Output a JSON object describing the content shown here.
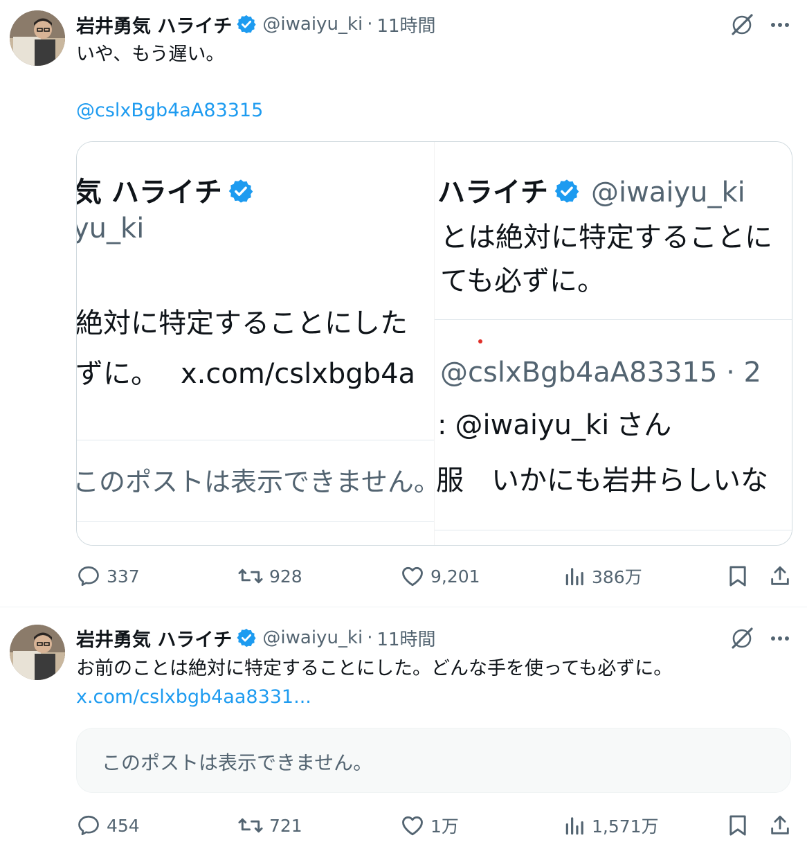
{
  "tweets": [
    {
      "author_name": "岩井勇気 ハライチ",
      "handle": "@iwaiyu_ki",
      "separator": "·",
      "time": "11時間",
      "text": "いや、もう遅い。",
      "mention": "@cslxBgb4aA83315",
      "stats": {
        "replies": "337",
        "reposts": "928",
        "likes": "9,201",
        "views": "386万"
      }
    },
    {
      "author_name": "岩井勇気 ハライチ",
      "handle": "@iwaiyu_ki",
      "separator": "·",
      "time": "11時間",
      "text": "お前のことは絶対に特定することにした。どんな手を使っても必ずに。",
      "link": "x.com/cslxbgb4aa8331...",
      "quoted_unavailable": "このポストは表示できません。",
      "stats": {
        "replies": "454",
        "reposts": "721",
        "likes": "1万",
        "views": "1,571万"
      }
    }
  ],
  "card": {
    "left": {
      "name_fragment": "気 ハライチ",
      "handle_fragment": "yu_ki",
      "line1": "絶対に特定することにした",
      "line2_prefix": "ずに。",
      "line2_link": "x.com/cslxbgb4a",
      "unavailable": "このポストは表示できません。"
    },
    "right": {
      "name_fragment": "ハライチ",
      "handle": "@iwaiyu_ki",
      "line1": "とは絶対に特定することに",
      "line2": "ても必ずに。",
      "reply_handle": "@cslxBgb4aA83315 · 2",
      "reply_to_prefix": ":",
      "reply_to_handle": "@iwaiyu_ki",
      "reply_to_suffix": "さん",
      "reply_text": "服　いかにも岩井らしいな"
    }
  },
  "colors": {
    "link": "#1d9bf0",
    "muted": "#536471",
    "verified": "#1d9bf0"
  }
}
